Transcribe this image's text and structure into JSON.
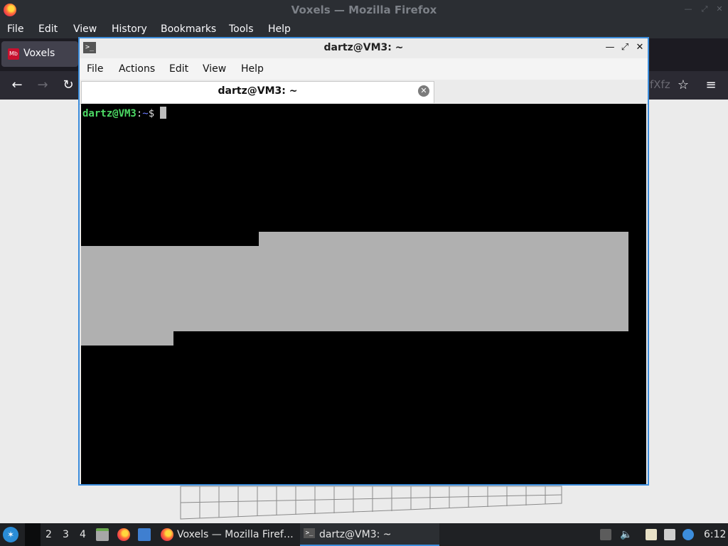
{
  "firefox": {
    "title": "Voxels — Mozilla Firefox",
    "menu": [
      "File",
      "Edit",
      "View",
      "History",
      "Bookmarks",
      "Tools",
      "Help"
    ],
    "tab_label": "Voxels",
    "tab_favicon_text": "Mb",
    "url_tail": "fXfz"
  },
  "terminal": {
    "title": "dartz@VM3: ~",
    "menu": [
      "File",
      "Actions",
      "Edit",
      "View",
      "Help"
    ],
    "tab_label": "dartz@VM3: ~",
    "prompt_user": "dartz@VM3",
    "prompt_sep": ":",
    "prompt_path": "~",
    "prompt_symbol": "$",
    "colors": {
      "user": "#4cd964",
      "path": "#6b7bff",
      "text": "#dddddd",
      "selection": "#b0b0b0",
      "background": "#000000"
    }
  },
  "taskbar": {
    "workspaces": [
      "2",
      "3",
      "4"
    ],
    "windows": [
      {
        "label": "Voxels — Mozilla Firef…",
        "icon": "firefox-icon"
      },
      {
        "label": "dartz@VM3: ~",
        "icon": "terminal-icon"
      }
    ],
    "clock": "6:12"
  }
}
